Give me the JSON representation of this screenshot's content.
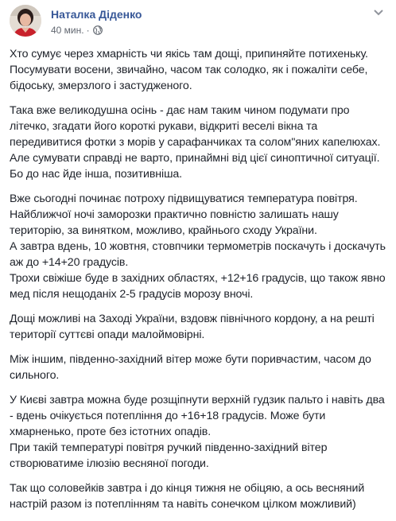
{
  "post": {
    "author": "Наталка Діденко",
    "time": "40 мин.",
    "separator": "·",
    "privacy_icon": "globe-icon",
    "menu_icon": "chevron-down-icon",
    "colors": {
      "author": "#385898",
      "text": "#1d2129",
      "meta": "#616770"
    },
    "paragraphs": [
      {
        "lines": [
          "Хто сумує через хмарність чи якісь там дощі, припиняйте потихеньку.",
          "Посумувати восени, звичайно, часом так солодко, як і пожаліти себе,",
          "бідоську, змерзлого і застудженого."
        ]
      },
      {
        "lines": [
          "Така вже великодушна осінь - дає нам таким чином подумати про",
          "літечко, згадати його короткі рукави, відкриті веселі вікна та",
          "передивитися фотки з морів у сарафанчиках та солом\"яних капелюхах.",
          "Але сумувати справді не варто, принаймні від цієї синоптичної ситуації.",
          "Бо до нас йде інша, позитивніша."
        ]
      },
      {
        "lines": [
          "Вже сьогодні починає потроху підвищуватися температура повітря.",
          "Найближчої ночі заморозки практично повністю залишать нашу",
          "територію, за винятком, можливо, крайнього сходу України.",
          "А завтра вдень, 10 жовтня, стовпчики термометрів поскачуть і доскачуть",
          "аж до +14+20 градусів.",
          "Трохи свіжіше буде в західних областях, +12+16 градусів, що також явно",
          "мед після нещоданіх 2-5 градусів морозу вночі."
        ]
      },
      {
        "lines": [
          "Дощі можливі на Заході України, вздовж північного кордону, а на решті",
          "території суттєві опади малоймовірні."
        ]
      },
      {
        "lines": [
          "Між іншим, південно-західний вітер може бути поривчастим, часом до",
          "сильного."
        ]
      },
      {
        "lines": [
          "У Києві завтра можна буде розщіпнути верхній гудзик пальто і навіть два",
          "- вдень очікується потепління до +16+18 градусів. Може бути",
          "хмарненько, проте без істотних опадів.",
          "При такій температурі повітря ручкий південно-західний вітер",
          "створюватиме ілюзію весняної погоди."
        ]
      },
      {
        "lines": [
          "Так що соловейків завтра і до кінця тижня не обіцяю, а ось весняний",
          "настрій разом із потеплінням та навіть сонечком цілком можливий)"
        ]
      }
    ]
  }
}
